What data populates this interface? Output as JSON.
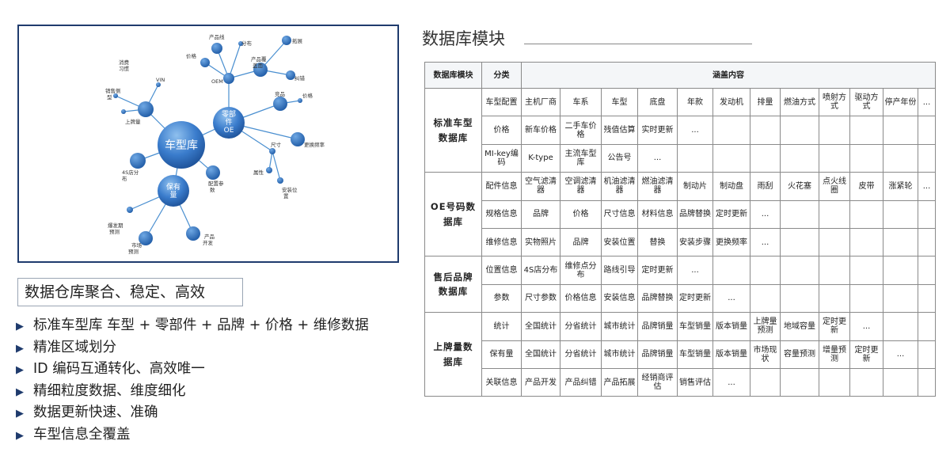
{
  "diagram": {
    "hubs": {
      "car_model": "车型库",
      "parts_oe": [
        "零部",
        "件",
        "OE"
      ],
      "holdings": [
        "保有",
        "量"
      ]
    },
    "labels": {
      "product_line": "产品线",
      "brand": "分布",
      "price_top": "价格",
      "expand": "拓展",
      "product_cover": [
        "产品覆",
        "盖面"
      ],
      "oem": "OEM",
      "error_correct": "纠错",
      "consume_habit": [
        "消费",
        "习惯"
      ],
      "vin": "VIN",
      "competitor": "竞品",
      "price_right": "价格",
      "sales_forecast": [
        "销售侧",
        "型"
      ],
      "registration": "上牌量",
      "replace_freq": "更换频率",
      "size": "尺寸",
      "store_4s": [
        "4S店分",
        "布"
      ],
      "attribute": "属性",
      "config_params": [
        "配置参",
        "数"
      ],
      "install_pos": [
        "安装位",
        "置"
      ],
      "outbreak_forecast": [
        "爆发期",
        "预测"
      ],
      "market_forecast": [
        "市场",
        "预测"
      ],
      "product_dev": [
        "产品",
        "开发"
      ]
    }
  },
  "tagline": "数据仓库聚合、稳定、高效",
  "features": [
    "标准车型库  车型 + 零部件 + 品牌 + 价格 + 维修数据",
    "精准区域划分",
    "ID 编码互通转化、高效唯一",
    "精细粒度数据、维度细化",
    "数据更新快速、准确",
    "车型信息全覆盖"
  ],
  "right_title": "数据库模块",
  "table": {
    "headers": {
      "module": "数据库模块",
      "category": "分类",
      "content": "涵盖内容"
    },
    "groups": [
      {
        "module": [
          "标准车型",
          "数据库"
        ],
        "rows": [
          {
            "category": "车型配置",
            "cells": [
              "主机厂商",
              "车系",
              "车型",
              "底盘",
              "年款",
              "发动机",
              "排量",
              "燃油方式",
              "喷射方式",
              "驱动方式",
              "停产年份",
              "..."
            ]
          },
          {
            "category": "价格",
            "cells": [
              "新车价格",
              "二手车价格",
              "残值估算",
              "实时更新",
              "...",
              "",
              "",
              "",
              "",
              "",
              "",
              ""
            ]
          },
          {
            "category": "MI-key编码",
            "cells": [
              "K-type",
              "主流车型库",
              "公告号",
              "...",
              "",
              "",
              "",
              "",
              "",
              "",
              "",
              ""
            ]
          }
        ]
      },
      {
        "module": [
          "OE号码数",
          "据库"
        ],
        "rows": [
          {
            "category": "配件信息",
            "cells": [
              "空气滤清器",
              "空调滤清器",
              "机油滤清器",
              "燃油滤清器",
              "制动片",
              "制动盘",
              "雨刮",
              "火花塞",
              "点火线圈",
              "皮带",
              "涨紧轮",
              "..."
            ]
          },
          {
            "category": "规格信息",
            "cells": [
              "品牌",
              "价格",
              "尺寸信息",
              "材料信息",
              "品牌替换",
              "定时更新",
              "...",
              "",
              "",
              "",
              "",
              ""
            ]
          },
          {
            "category": "维修信息",
            "cells": [
              "实物照片",
              "品牌",
              "安装位置",
              "替换",
              "安装步骤",
              "更换频率",
              "...",
              "",
              "",
              "",
              "",
              ""
            ]
          }
        ]
      },
      {
        "module": [
          "售后品牌",
          "数据库"
        ],
        "rows": [
          {
            "category": "位置信息",
            "cells": [
              "4S店分布",
              "维修点分布",
              "路线引导",
              "定时更新",
              "...",
              "",
              "",
              "",
              "",
              "",
              "",
              ""
            ]
          },
          {
            "category": "参数",
            "cells": [
              "尺寸参数",
              "价格信息",
              "安装信息",
              "品牌替换",
              "定时更新",
              "...",
              "",
              "",
              "",
              "",
              "",
              ""
            ]
          }
        ]
      },
      {
        "module": [
          "上牌量数",
          "据库"
        ],
        "rows": [
          {
            "category": "统计",
            "cells": [
              "全国统计",
              "分省统计",
              "城市统计",
              "品牌销量",
              "车型销量",
              "版本销量",
              "上牌量预测",
              "地域容量",
              "定时更新",
              "...",
              "",
              ""
            ]
          },
          {
            "category": "保有量",
            "cells": [
              "全国统计",
              "分省统计",
              "城市统计",
              "品牌销量",
              "车型销量",
              "版本销量",
              "市场现状",
              "容量预测",
              "增量预测",
              "定时更新",
              "...",
              ""
            ]
          },
          {
            "category": "关联信息",
            "cells": [
              "产品开发",
              "产品纠错",
              "产品拓展",
              "经销商评估",
              "销售评估",
              "...",
              "",
              "",
              "",
              "",
              "",
              ""
            ]
          }
        ]
      }
    ]
  },
  "colors": {
    "node": "#2f6db5",
    "edge": "#4a8fd0",
    "border": "#1f3b6d"
  }
}
